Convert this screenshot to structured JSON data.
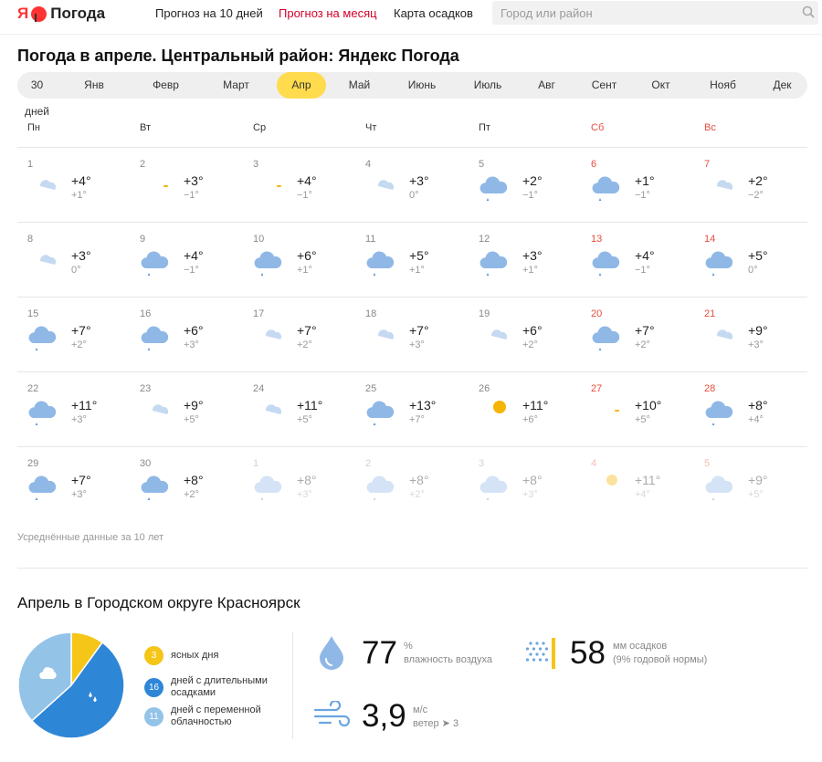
{
  "header": {
    "logo_mark": "Я",
    "logo_text": "Погода",
    "nav": [
      "Прогноз на 10 дней",
      "Прогноз на месяц",
      "Карта осадков"
    ],
    "search_placeholder": "Город или район"
  },
  "page_title": "Погода в апреле. Центральный район: Яндекс Погода",
  "tabs": [
    "30 дней",
    "Янв",
    "Февр",
    "Март",
    "Апр",
    "Май",
    "Июнь",
    "Июль",
    "Авг",
    "Сент",
    "Окт",
    "Нояб",
    "Дек"
  ],
  "active_tab": "Апр",
  "weekdays": [
    "Пн",
    "Вт",
    "Ср",
    "Чт",
    "Пт",
    "Сб",
    "Вс"
  ],
  "days": [
    {
      "d": "1",
      "max": "+4°",
      "min": "+1°",
      "icon": "cloud-sun-icon"
    },
    {
      "d": "2",
      "max": "+3°",
      "min": "−1°",
      "icon": "sun-icon"
    },
    {
      "d": "3",
      "max": "+4°",
      "min": "−1°",
      "icon": "sun-icon"
    },
    {
      "d": "4",
      "max": "+3°",
      "min": "0°",
      "icon": "cloud-sun-icon"
    },
    {
      "d": "5",
      "max": "+2°",
      "min": "−1°",
      "icon": "cloud-rain-icon"
    },
    {
      "d": "6",
      "max": "+1°",
      "min": "−1°",
      "icon": "cloud-rain-icon"
    },
    {
      "d": "7",
      "max": "+2°",
      "min": "−2°",
      "icon": "cloud-sun-icon"
    },
    {
      "d": "8",
      "max": "+3°",
      "min": "0°",
      "icon": "cloud-sun-icon"
    },
    {
      "d": "9",
      "max": "+4°",
      "min": "−1°",
      "icon": "cloud-rain-icon"
    },
    {
      "d": "10",
      "max": "+6°",
      "min": "+1°",
      "icon": "cloud-rain-icon"
    },
    {
      "d": "11",
      "max": "+5°",
      "min": "+1°",
      "icon": "cloud-rain-icon"
    },
    {
      "d": "12",
      "max": "+3°",
      "min": "+1°",
      "icon": "cloud-rain-icon"
    },
    {
      "d": "13",
      "max": "+4°",
      "min": "−1°",
      "icon": "cloud-rain-icon"
    },
    {
      "d": "14",
      "max": "+5°",
      "min": "0°",
      "icon": "cloud-rain-icon"
    },
    {
      "d": "15",
      "max": "+7°",
      "min": "+2°",
      "icon": "cloud-rain-icon"
    },
    {
      "d": "16",
      "max": "+6°",
      "min": "+3°",
      "icon": "cloud-rain-icon"
    },
    {
      "d": "17",
      "max": "+7°",
      "min": "+2°",
      "icon": "cloud-sun-icon"
    },
    {
      "d": "18",
      "max": "+7°",
      "min": "+3°",
      "icon": "cloud-sun-icon"
    },
    {
      "d": "19",
      "max": "+6°",
      "min": "+2°",
      "icon": "cloud-sun-icon"
    },
    {
      "d": "20",
      "max": "+7°",
      "min": "+2°",
      "icon": "cloud-rain-icon"
    },
    {
      "d": "21",
      "max": "+9°",
      "min": "+3°",
      "icon": "cloud-sun-icon"
    },
    {
      "d": "22",
      "max": "+11°",
      "min": "+3°",
      "icon": "cloud-rain-icon"
    },
    {
      "d": "23",
      "max": "+9°",
      "min": "+5°",
      "icon": "cloud-sun-icon"
    },
    {
      "d": "24",
      "max": "+11°",
      "min": "+5°",
      "icon": "cloud-sun-icon"
    },
    {
      "d": "25",
      "max": "+13°",
      "min": "+7°",
      "icon": "cloud-rain-icon"
    },
    {
      "d": "26",
      "max": "+11°",
      "min": "+6°",
      "icon": "partly-sunny-icon"
    },
    {
      "d": "27",
      "max": "+10°",
      "min": "+5°",
      "icon": "sun-icon"
    },
    {
      "d": "28",
      "max": "+8°",
      "min": "+4°",
      "icon": "cloud-rain-icon"
    },
    {
      "d": "29",
      "max": "+7°",
      "min": "+3°",
      "icon": "cloud-rain-icon"
    },
    {
      "d": "30",
      "max": "+8°",
      "min": "+2°",
      "icon": "cloud-rain-icon"
    },
    {
      "d": "1",
      "max": "+8°",
      "min": "+3°",
      "icon": "cloud-rain-icon",
      "faded": true
    },
    {
      "d": "2",
      "max": "+8°",
      "min": "+2°",
      "icon": "cloud-rain-icon",
      "faded": true
    },
    {
      "d": "3",
      "max": "+8°",
      "min": "+3°",
      "icon": "cloud-rain-icon",
      "faded": true
    },
    {
      "d": "4",
      "max": "+11°",
      "min": "+4°",
      "icon": "partly-sunny-rain-icon",
      "faded": true
    },
    {
      "d": "5",
      "max": "+9°",
      "min": "+5°",
      "icon": "cloud-rain-icon",
      "faded": true
    }
  ],
  "note": "Усреднённые данные за 10 лет",
  "summary": {
    "title": "Апрель в Городском округе Красноярск",
    "legend": [
      {
        "count": "3",
        "label": "ясных дня",
        "color": "#f5c518"
      },
      {
        "count": "16",
        "label": "дней с длительными осадками",
        "color": "#2d86d6"
      },
      {
        "count": "11",
        "label": "дней с переменной облачностью",
        "color": "#94c3e8"
      }
    ],
    "humidity": {
      "value": "77",
      "unit": "%",
      "label": "влажность воздуха"
    },
    "precip": {
      "value": "58",
      "unit": "мм осадков",
      "label": "(9% годовой нормы)"
    },
    "wind": {
      "value": "3,9",
      "unit": "м/с",
      "label": "ветер ➤ 3"
    }
  },
  "colors": {
    "accent": "#ffdb4d",
    "weekend": "#e74c3c",
    "brand": "#ff3333"
  }
}
